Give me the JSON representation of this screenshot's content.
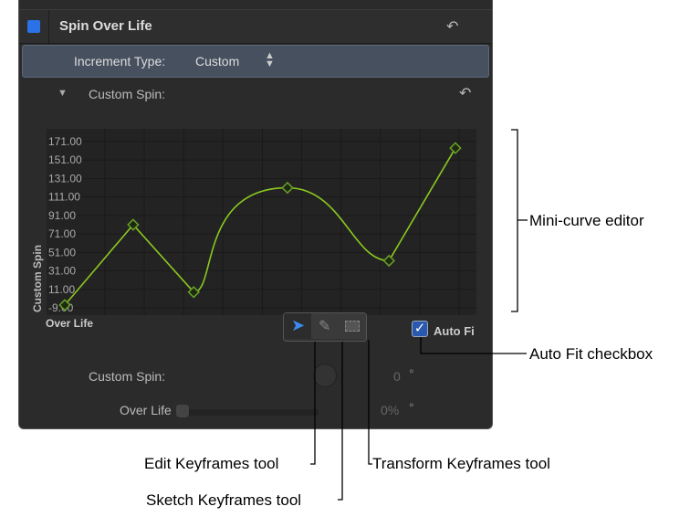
{
  "header": {
    "title": "Spin Over Life",
    "enabled": true
  },
  "increment": {
    "label": "Increment Type:",
    "value": "Custom"
  },
  "custom_spin_section": {
    "label": "Custom Spin:"
  },
  "chart_data": {
    "type": "line",
    "ylabel": "Custom Spin",
    "xlabel": "Over Life",
    "yticks": [
      "171.00",
      "151.00",
      "131.00",
      "111.00",
      "91.00",
      "71.00",
      "51.00",
      "31.00",
      "11.00",
      "-9.00"
    ],
    "ylim": [
      -9,
      171
    ],
    "xlim": [
      0,
      100
    ],
    "keyframes": [
      {
        "x": 0,
        "y": -7
      },
      {
        "x": 17.5,
        "y": 80
      },
      {
        "x": 33,
        "y": 7
      },
      {
        "x": 57,
        "y": 120
      },
      {
        "x": 83,
        "y": 41
      },
      {
        "x": 100,
        "y": 163
      }
    ],
    "curve_color": "#8ac820"
  },
  "tools": {
    "auto_fit_label": "Auto Fi",
    "auto_fit_checked": true
  },
  "params": {
    "custom_spin_label": "Custom Spin:",
    "custom_spin_value": "0",
    "custom_spin_unit": "°",
    "over_life_label": "Over Life",
    "over_life_value": "0%",
    "over_life_unit": "°",
    "over_life_fraction": 0
  },
  "annotations": {
    "mini_curve": "Mini-curve editor",
    "auto_fit": "Auto Fit checkbox",
    "edit_tool": "Edit Keyframes tool",
    "sketch_tool": "Sketch Keyframes tool",
    "transform_tool": "Transform Keyframes tool"
  }
}
